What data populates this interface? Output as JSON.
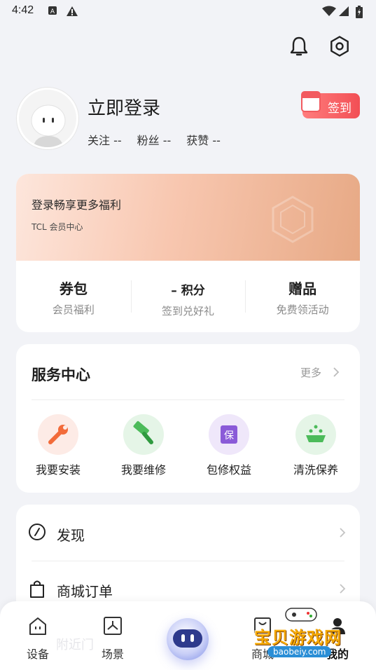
{
  "status_bar": {
    "time": "4:42",
    "icons": [
      "a-box-icon",
      "warning-icon",
      "wifi-icon",
      "signal-icon",
      "battery-icon"
    ]
  },
  "header": {
    "icons": [
      "bell-icon",
      "gear-icon"
    ]
  },
  "profile": {
    "login_label": "立即登录",
    "stats": [
      "关注 --",
      "粉丝 --",
      "获赞 --"
    ],
    "checkin_label": "签到"
  },
  "member": {
    "banner_title": "登录畅享更多福利",
    "banner_subtitle": "TCL 会员中心",
    "items": [
      {
        "title": "券包",
        "subtitle": "会员福利"
      },
      {
        "title": "– 积分",
        "subtitle": "签到兑好礼"
      },
      {
        "title": "赠品",
        "subtitle": "免费领活动"
      }
    ]
  },
  "service": {
    "title": "服务中心",
    "more": "更多",
    "items": [
      {
        "label": "我要安装",
        "icon": "wrench-icon",
        "color": "#f26b3a"
      },
      {
        "label": "我要维修",
        "icon": "hammer-icon",
        "color": "#4cbb5a"
      },
      {
        "label": "包修权益",
        "icon": "warranty-icon",
        "color": "#8a5ad8"
      },
      {
        "label": "清洗保养",
        "icon": "clean-icon",
        "color": "#4cbb5a"
      }
    ]
  },
  "menu": {
    "items": [
      {
        "label": "发现",
        "icon": "compass-icon"
      },
      {
        "label": "商城订单",
        "icon": "shopping-bag-icon"
      }
    ]
  },
  "tabbar": {
    "items": [
      {
        "label": "设备",
        "icon": "device-icon"
      },
      {
        "label": "场景",
        "icon": "scene-icon"
      },
      {
        "label": "",
        "icon": "robot-icon"
      },
      {
        "label": "商城",
        "icon": "mall-icon"
      },
      {
        "label": "我的",
        "icon": "profile-icon"
      }
    ],
    "ghost_text": "附近门"
  },
  "watermark": {
    "text": "宝贝游戏网",
    "url": "baobeiy.com"
  }
}
